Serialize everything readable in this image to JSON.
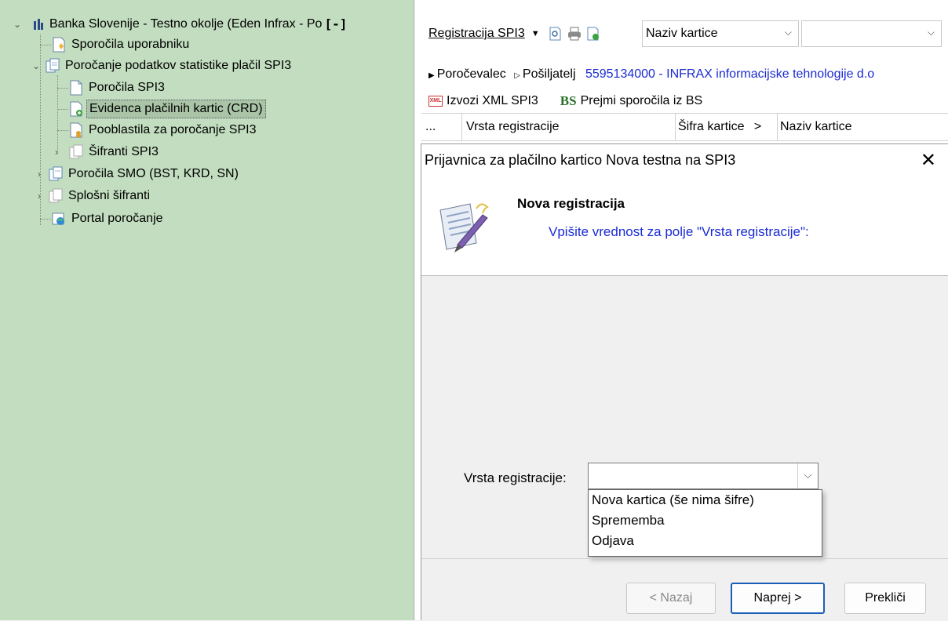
{
  "tree": {
    "root": {
      "label": "Banka Slovenije - Testno okolje (Eden Infrax - Po",
      "collapse_btn": "[-]"
    },
    "items": [
      {
        "label": "Sporočila uporabniku"
      },
      {
        "label": "Poročanje podatkov statistike plačil SPI3"
      },
      {
        "label": "Poročila SPI3"
      },
      {
        "label": "Evidenca plačilnih kartic (CRD)"
      },
      {
        "label": "Pooblastila za poročanje SPI3"
      },
      {
        "label": "Šifranti SPI3"
      },
      {
        "label": "Poročila SMO (BST, KRD, SN)"
      },
      {
        "label": "Splošni šifranti"
      },
      {
        "label": "Portal poročanje"
      }
    ]
  },
  "toolbar": {
    "menu_label": "Registracija SPI3",
    "field_combo_value": "Naziv kartice",
    "search_combo_value": ""
  },
  "breadcrumb": {
    "item1": "Poročevalec",
    "item2": "Pošiljatelj",
    "company": "5595134000 - INFRAX informacijske tehnologije d.o"
  },
  "actions": {
    "export_xml": "Izvozi XML SPI3",
    "bs_logo": "BS",
    "receive": "Prejmi sporočila iz BS"
  },
  "grid": {
    "columns": [
      "...",
      "Vrsta registracije",
      "Šifra kartice",
      ">",
      "Naziv kartice"
    ]
  },
  "dialog": {
    "title": "Prijavnica za plačilno kartico Nova testna na SPI3",
    "close": "✕",
    "heading": "Nova registracija",
    "prompt": "Vpišite vrednost za polje \"Vrsta registracije\":",
    "field_label": "Vrsta registracije:",
    "field_value": "",
    "options": [
      "Nova kartica (še nima šifre)",
      "Sprememba",
      "Odjava"
    ],
    "buttons": {
      "back": "< Nazaj",
      "next": "Naprej >",
      "cancel": "Prekliči"
    }
  },
  "colors": {
    "tree_bg": "#c2ddbf",
    "link_blue": "#1a2bd4",
    "primary_border": "#1a5fb4"
  }
}
